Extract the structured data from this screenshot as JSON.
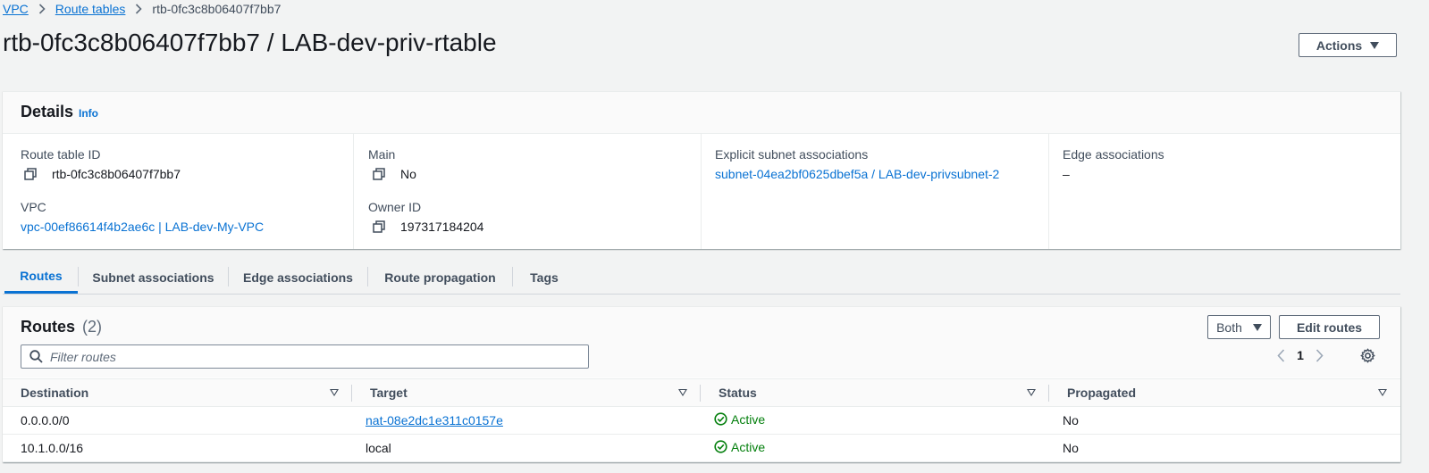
{
  "breadcrumb": {
    "vpc": "VPC",
    "route_tables": "Route tables",
    "current": "rtb-0fc3c8b06407f7bb7"
  },
  "header": {
    "title": "rtb-0fc3c8b06407f7bb7 / LAB-dev-priv-rtable",
    "actions_label": "Actions"
  },
  "details": {
    "title": "Details",
    "info": "Info",
    "route_table_id_label": "Route table ID",
    "route_table_id": "rtb-0fc3c8b06407f7bb7",
    "vpc_label": "VPC",
    "vpc": "vpc-00ef86614f4b2ae6c | LAB-dev-My-VPC",
    "main_label": "Main",
    "main": "No",
    "owner_label": "Owner ID",
    "owner": "197317184204",
    "explicit_label": "Explicit subnet associations",
    "explicit": "subnet-04ea2bf0625dbef5a / LAB-dev-privsubnet-2",
    "edge_label": "Edge associations",
    "edge": "–"
  },
  "tabs": [
    "Routes",
    "Subnet associations",
    "Edge associations",
    "Route propagation",
    "Tags"
  ],
  "routes": {
    "title": "Routes",
    "count": "(2)",
    "both_label": "Both",
    "edit_label": "Edit routes",
    "filter_placeholder": "Filter routes",
    "page": "1",
    "columns": [
      "Destination",
      "Target",
      "Status",
      "Propagated"
    ],
    "rows": [
      {
        "destination": "0.0.0.0/0",
        "target": "nat-08e2dc1e311c0157e",
        "status": "Active",
        "propagated": "No"
      },
      {
        "destination": "10.1.0.0/16",
        "target": "local",
        "status": "Active",
        "propagated": "No"
      }
    ]
  },
  "colors": {
    "link": "#0972d3",
    "success": "#037f0c",
    "text": "#16191f"
  },
  "icons": [
    "chevron-right-icon",
    "caret-down-icon",
    "copy-icon",
    "search-icon",
    "chevron-left-icon",
    "gear-icon",
    "status-success-icon",
    "sort-icon"
  ]
}
